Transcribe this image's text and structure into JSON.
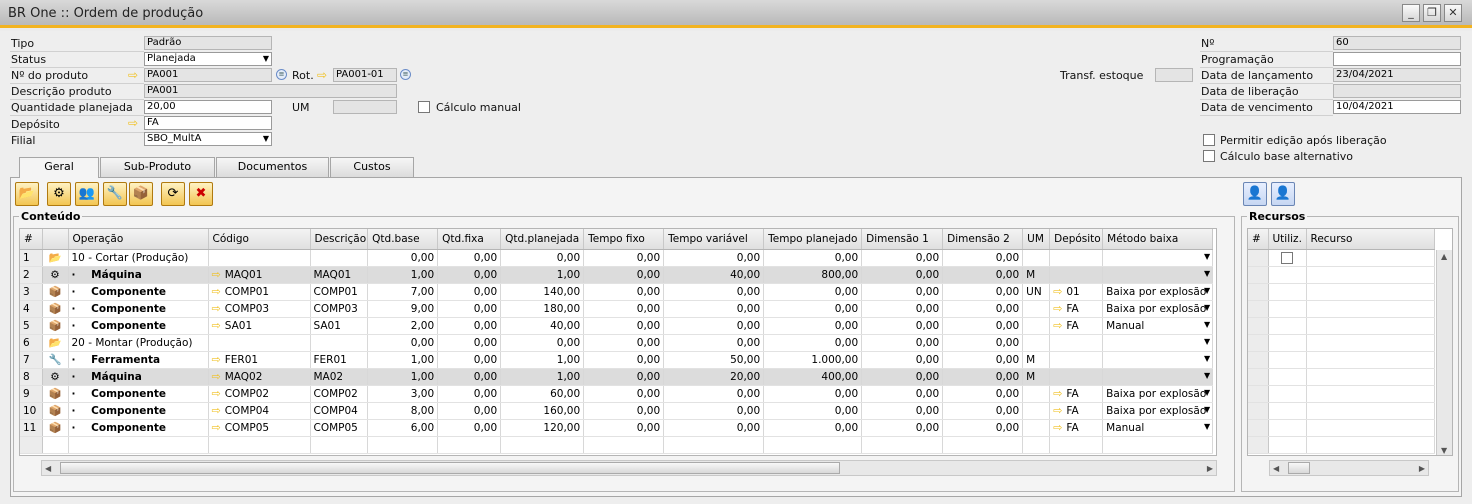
{
  "window": {
    "title": "BR One :: Ordem de produção"
  },
  "form": {
    "tipo_label": "Tipo",
    "tipo_value": "Padrão",
    "status_label": "Status",
    "status_value": "Planejada",
    "produto_label": "Nº do produto",
    "produto_value": "PA001",
    "rot_label": "Rot.",
    "rot_value": "PA001-01",
    "descricao_label": "Descrição produto",
    "descricao_value": "PA001",
    "qtd_label": "Quantidade planejada",
    "qtd_value": "20,00",
    "um_label": "UM",
    "um_value": "",
    "calculo_manual_label": "Cálculo manual",
    "deposito_label": "Depósito",
    "deposito_value": "FA",
    "filial_label": "Filial",
    "filial_value": "SBO_MultA",
    "transf_label": "Transf. estoque",
    "no_label": "Nº",
    "no_value": "60",
    "programacao_label": "Programação",
    "programacao_value": "",
    "lancamento_label": "Data de lançamento",
    "lancamento_value": "23/04/2021",
    "liberacao_label": "Data de liberação",
    "liberacao_value": "",
    "vencimento_label": "Data de vencimento",
    "vencimento_value": "10/04/2021",
    "permitir_label": "Permitir edição após liberação",
    "calculo_alt_label": "Cálculo base alternativo"
  },
  "tabs": [
    "Geral",
    "Sub-Produto",
    "Documentos",
    "Custos"
  ],
  "conteudo": {
    "title": "Conteúdo",
    "columns": [
      "#",
      "",
      "Operação",
      "Código",
      "Descrição",
      "Qtd.base",
      "Qtd.fixa",
      "Qtd.planejada",
      "Tempo fixo",
      "Tempo variável",
      "Tempo planejado",
      "Dimensão 1",
      "Dimensão 2",
      "UM",
      "Depósito",
      "Método baixa"
    ],
    "rows": [
      {
        "n": "1",
        "type": "header",
        "icon": "folder",
        "op": "10 - Cortar (Produção)",
        "cod": "",
        "desc": "",
        "base": "0,00",
        "fixa": "0,00",
        "plan": "0,00",
        "tf": "0,00",
        "tv": "0,00",
        "tp": "0,00",
        "d1": "0,00",
        "d2": "0,00",
        "um": "",
        "dep": "",
        "met": ""
      },
      {
        "n": "2",
        "type": "mach",
        "icon": "gear",
        "op": "Máquina",
        "cod": "MAQ01",
        "desc": "MAQ01",
        "base": "1,00",
        "fixa": "0,00",
        "plan": "1,00",
        "tf": "0,00",
        "tv": "40,00",
        "tp": "800,00",
        "d1": "0,00",
        "d2": "0,00",
        "um": "M",
        "dep": "",
        "met": ""
      },
      {
        "n": "3",
        "type": "norm",
        "icon": "box",
        "op": "Componente",
        "cod": "COMP01",
        "desc": "COMP01",
        "base": "7,00",
        "fixa": "0,00",
        "plan": "140,00",
        "tf": "0,00",
        "tv": "0,00",
        "tp": "0,00",
        "d1": "0,00",
        "d2": "0,00",
        "um": "UN",
        "dep": "01",
        "met": "Baixa por explosão"
      },
      {
        "n": "4",
        "type": "norm",
        "icon": "box",
        "op": "Componente",
        "cod": "COMP03",
        "desc": "COMP03",
        "base": "9,00",
        "fixa": "0,00",
        "plan": "180,00",
        "tf": "0,00",
        "tv": "0,00",
        "tp": "0,00",
        "d1": "0,00",
        "d2": "0,00",
        "um": "",
        "dep": "FA",
        "met": "Baixa por explosão"
      },
      {
        "n": "5",
        "type": "norm",
        "icon": "box",
        "op": "Componente",
        "cod": "SA01",
        "desc": "SA01",
        "base": "2,00",
        "fixa": "0,00",
        "plan": "40,00",
        "tf": "0,00",
        "tv": "0,00",
        "tp": "0,00",
        "d1": "0,00",
        "d2": "0,00",
        "um": "",
        "dep": "FA",
        "met": "Manual"
      },
      {
        "n": "6",
        "type": "header",
        "icon": "folder",
        "op": "20 - Montar (Produção)",
        "cod": "",
        "desc": "",
        "base": "0,00",
        "fixa": "0,00",
        "plan": "0,00",
        "tf": "0,00",
        "tv": "0,00",
        "tp": "0,00",
        "d1": "0,00",
        "d2": "0,00",
        "um": "",
        "dep": "",
        "met": ""
      },
      {
        "n": "7",
        "type": "norm",
        "icon": "wrench",
        "op": "Ferramenta",
        "cod": "FER01",
        "desc": "FER01",
        "base": "1,00",
        "fixa": "0,00",
        "plan": "1,00",
        "tf": "0,00",
        "tv": "50,00",
        "tp": "1.000,00",
        "d1": "0,00",
        "d2": "0,00",
        "um": "M",
        "dep": "",
        "met": ""
      },
      {
        "n": "8",
        "type": "mach",
        "icon": "gear",
        "op": "Máquina",
        "cod": "MAQ02",
        "desc": "MA02",
        "base": "1,00",
        "fixa": "0,00",
        "plan": "1,00",
        "tf": "0,00",
        "tv": "20,00",
        "tp": "400,00",
        "d1": "0,00",
        "d2": "0,00",
        "um": "M",
        "dep": "",
        "met": ""
      },
      {
        "n": "9",
        "type": "norm",
        "icon": "box",
        "op": "Componente",
        "cod": "COMP02",
        "desc": "COMP02",
        "base": "3,00",
        "fixa": "0,00",
        "plan": "60,00",
        "tf": "0,00",
        "tv": "0,00",
        "tp": "0,00",
        "d1": "0,00",
        "d2": "0,00",
        "um": "",
        "dep": "FA",
        "met": "Baixa por explosão"
      },
      {
        "n": "10",
        "type": "norm",
        "icon": "box",
        "op": "Componente",
        "cod": "COMP04",
        "desc": "COMP04",
        "base": "8,00",
        "fixa": "0,00",
        "plan": "160,00",
        "tf": "0,00",
        "tv": "0,00",
        "tp": "0,00",
        "d1": "0,00",
        "d2": "0,00",
        "um": "",
        "dep": "FA",
        "met": "Baixa por explosão"
      },
      {
        "n": "11",
        "type": "norm",
        "icon": "box",
        "op": "Componente",
        "cod": "COMP05",
        "desc": "COMP05",
        "base": "6,00",
        "fixa": "0,00",
        "plan": "120,00",
        "tf": "0,00",
        "tv": "0,00",
        "tp": "0,00",
        "d1": "0,00",
        "d2": "0,00",
        "um": "",
        "dep": "FA",
        "met": "Manual"
      }
    ]
  },
  "recursos": {
    "title": "Recursos",
    "columns": [
      "#",
      "Utiliz.",
      "Recurso"
    ]
  },
  "icons": [
    "folder-open-icon",
    "gear-icon",
    "users-icon",
    "wrench-icon",
    "boxes-icon",
    "refresh-icon",
    "delete-icon",
    "add-person-icon",
    "remove-person-icon"
  ]
}
